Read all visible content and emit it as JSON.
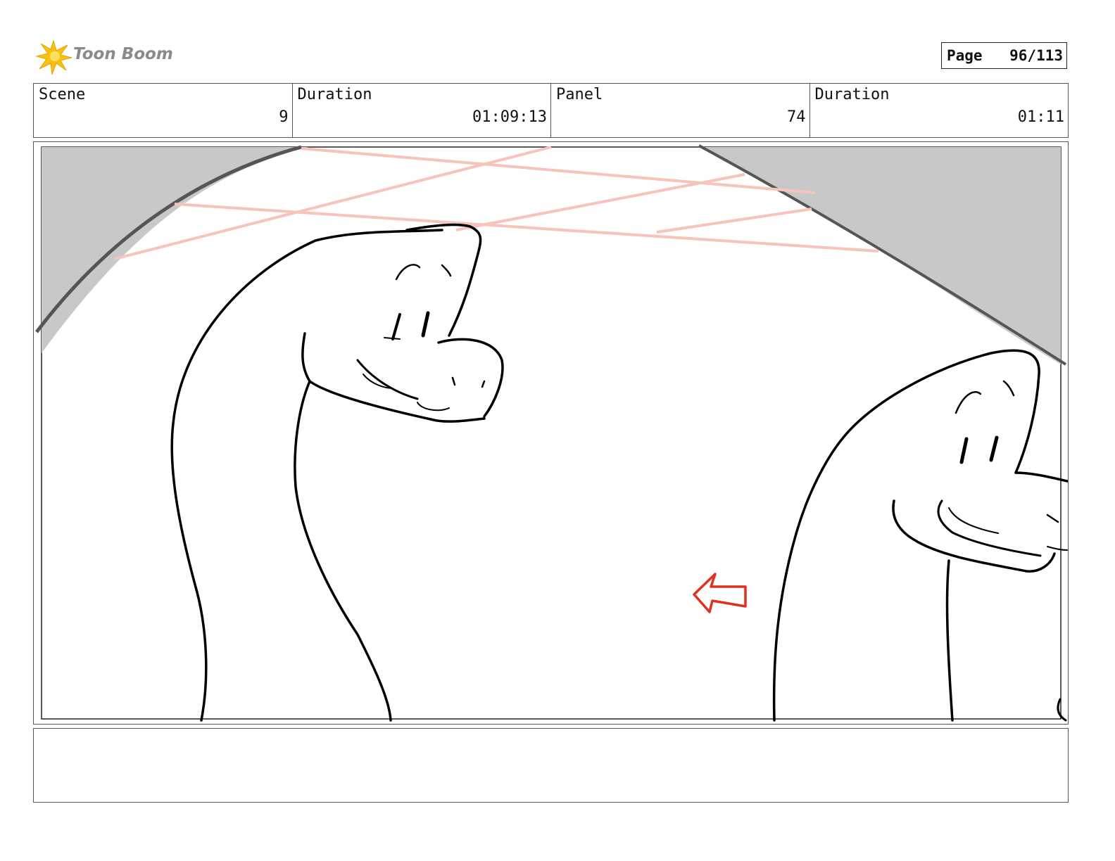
{
  "header": {
    "logo_text": "Toon Boom",
    "page_label": "Page",
    "page_value": "96/113"
  },
  "info": {
    "scene_label": "Scene",
    "scene_value": "9",
    "scene_duration_label": "Duration",
    "scene_duration_value": "01:09:13",
    "panel_label": "Panel",
    "panel_value": "74",
    "panel_duration_label": "Duration",
    "panel_duration_value": "01:11"
  },
  "notes": {
    "text": ""
  },
  "colors": {
    "arrow": "#e0301e",
    "guides": "#f7c4bb",
    "shading": "#c8c8c8"
  }
}
